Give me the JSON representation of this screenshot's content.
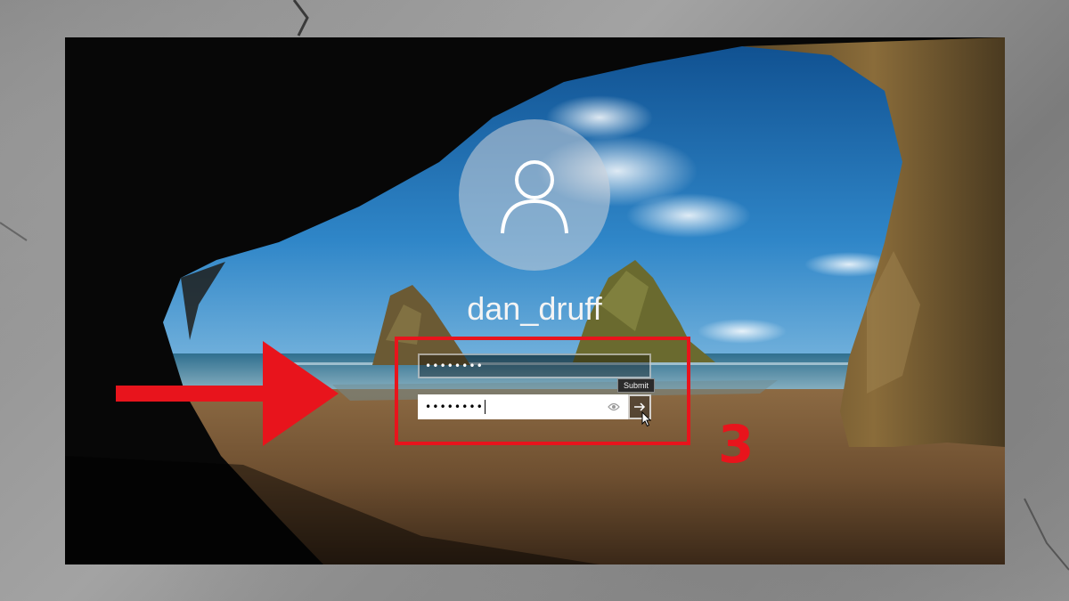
{
  "login": {
    "username": "dan_druff",
    "username_field_value": "••••••••",
    "password_field_value": "••••••••",
    "submit_tooltip": "Submit",
    "avatar_icon": "user-icon",
    "reveal_icon": "eye-icon",
    "submit_icon": "arrow-right-icon"
  },
  "annotation": {
    "step_number": "3",
    "color": "#e8141c",
    "arrow_icon": "red-arrow-right"
  }
}
